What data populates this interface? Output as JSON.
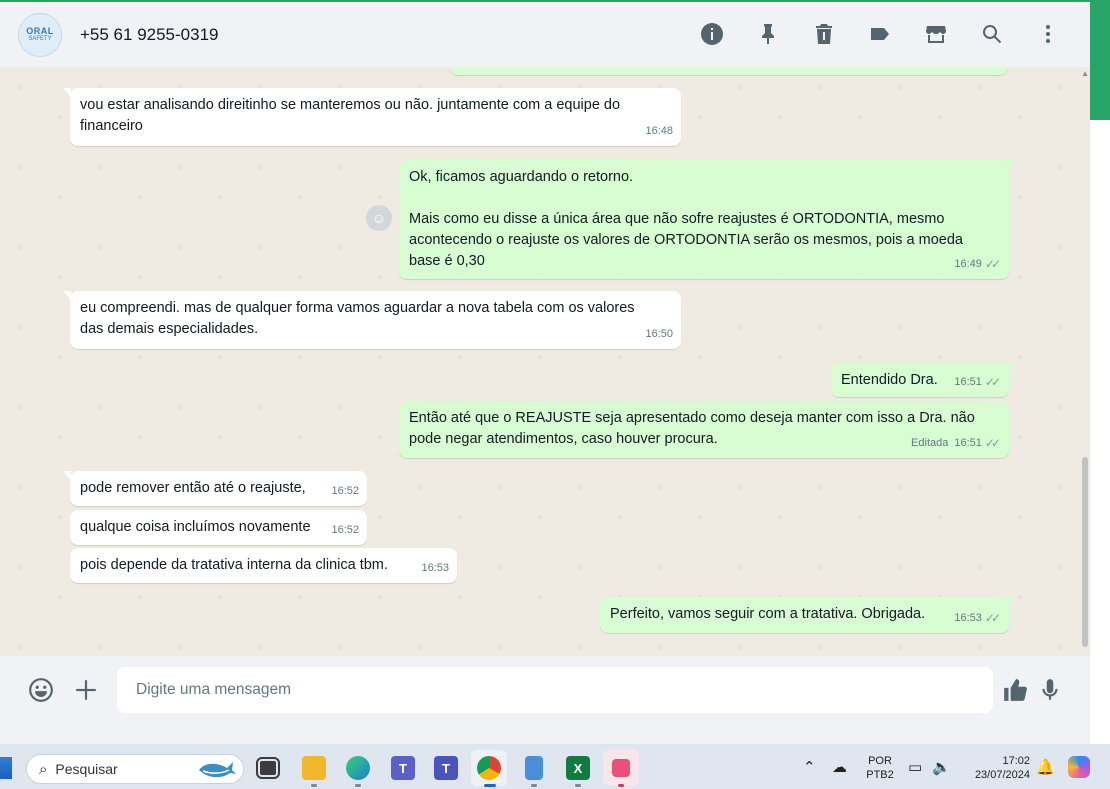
{
  "header": {
    "avatar_top": "ORAL",
    "avatar_bottom": "SAFETY",
    "contact_name": "+55 61 9255-0319"
  },
  "messages": [
    {
      "text": "vou estar analisando direitinho se manteremos ou não. juntamente com a equipe do\nfinanceiro",
      "time": "16:48"
    },
    {
      "text": "Ok, ficamos aguardando o retorno.\n\nMais como eu disse a única área que não sofre reajustes é ORTODONTIA, mesmo\nacontecendo o reajuste os valores de ORTODONTIA serão os mesmos, pois a moeda\nbase é 0,30",
      "time": "16:49"
    },
    {
      "text": "eu compreendi. mas de qualquer forma vamos aguardar a nova tabela com os valores\ndas demais especialidades.",
      "time": "16:50"
    },
    {
      "text": "Entendido Dra.",
      "time": "16:51"
    },
    {
      "text": "Então até que o REAJUSTE seja apresentado como deseja manter com isso a Dra. não\npode negar atendimentos, caso houver procura.",
      "time": "16:51",
      "edited": "Editada"
    },
    {
      "text": "pode remover então até o reajuste,",
      "time": "16:52"
    },
    {
      "text": "qualque coisa incluímos novamente",
      "time": "16:52"
    },
    {
      "text": "pois depende da tratativa interna da clinica tbm.",
      "time": "16:53"
    },
    {
      "text": "Perfeito, vamos seguir com a tratativa. Obrigada.",
      "time": "16:53"
    }
  ],
  "composer": {
    "placeholder": "Digite uma mensagem"
  },
  "taskbar": {
    "search_label": "Pesquisar",
    "language": "POR",
    "layout": "PTB2",
    "time": "17:02",
    "date": "23/07/2024"
  },
  "colors": {
    "accent": "#25a567",
    "incoming": "#ffffff",
    "outgoing": "#d9fdd3",
    "chat_bg": "#efeae2"
  }
}
